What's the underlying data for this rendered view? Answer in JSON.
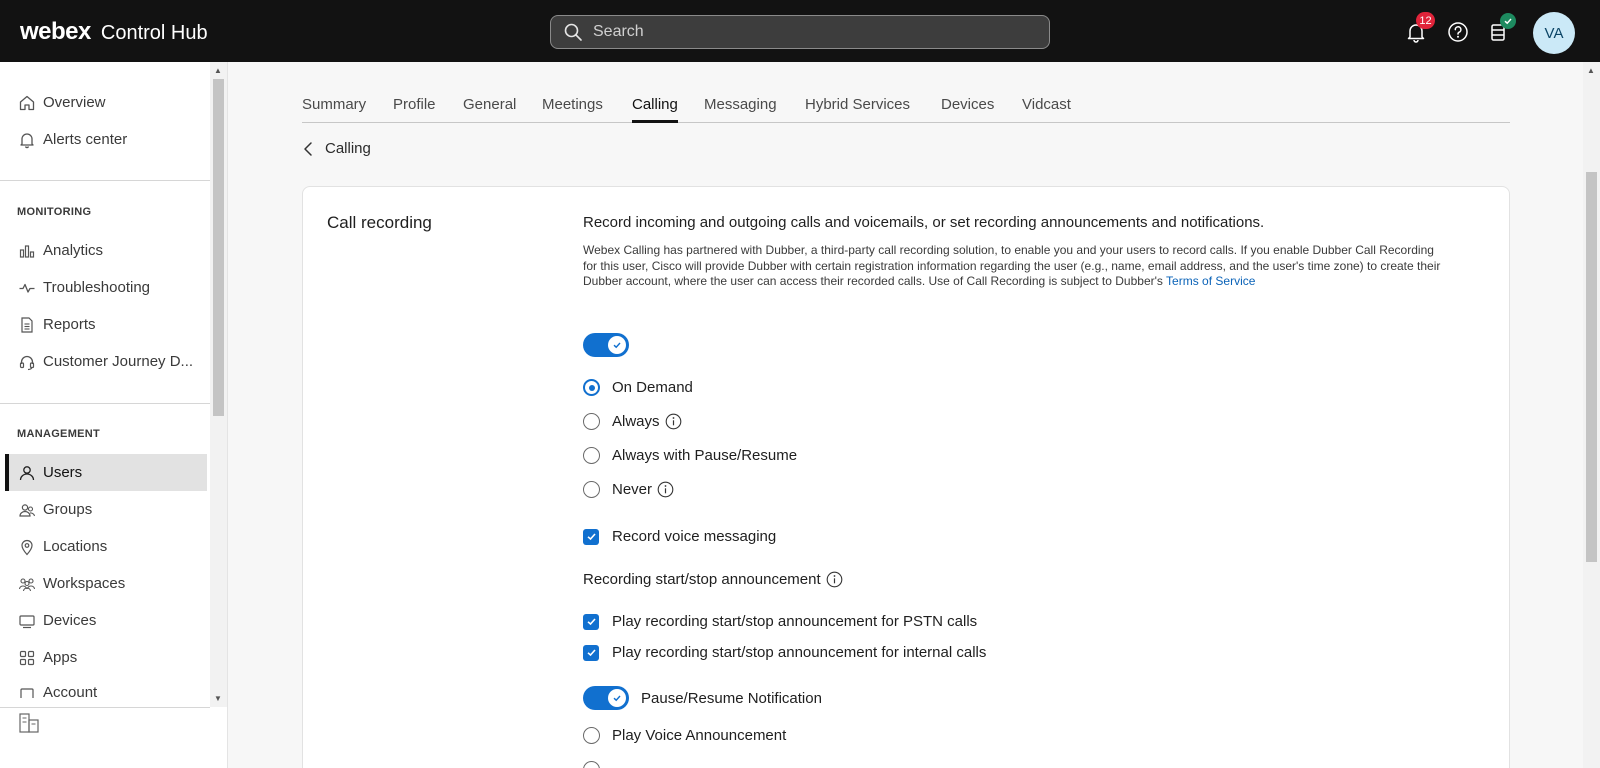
{
  "header": {
    "brand_webex": "webex",
    "brand_product": "Control Hub",
    "search_placeholder": "Search",
    "notification_count": "12",
    "avatar_initials": "VA"
  },
  "sidebar": {
    "top_items": [
      {
        "label": "Overview",
        "icon": "home-icon"
      },
      {
        "label": "Alerts center",
        "icon": "bell-icon"
      }
    ],
    "monitoring_label": "MONITORING",
    "monitoring_items": [
      {
        "label": "Analytics",
        "icon": "bar-chart-icon"
      },
      {
        "label": "Troubleshooting",
        "icon": "pulse-icon"
      },
      {
        "label": "Reports",
        "icon": "document-icon"
      },
      {
        "label": "Customer Journey D...",
        "icon": "headset-icon"
      }
    ],
    "management_label": "MANAGEMENT",
    "management_items": [
      {
        "label": "Users",
        "icon": "user-icon",
        "active": true
      },
      {
        "label": "Groups",
        "icon": "group-icon"
      },
      {
        "label": "Locations",
        "icon": "location-pin-icon"
      },
      {
        "label": "Workspaces",
        "icon": "workspaces-icon"
      },
      {
        "label": "Devices",
        "icon": "device-icon"
      },
      {
        "label": "Apps",
        "icon": "apps-grid-icon"
      },
      {
        "label": "Account",
        "icon": "account-icon"
      }
    ]
  },
  "tabs": [
    {
      "label": "Summary"
    },
    {
      "label": "Profile"
    },
    {
      "label": "General"
    },
    {
      "label": "Meetings"
    },
    {
      "label": "Calling",
      "active": true
    },
    {
      "label": "Messaging"
    },
    {
      "label": "Hybrid Services"
    },
    {
      "label": "Devices"
    },
    {
      "label": "Vidcast"
    }
  ],
  "breadcrumb": {
    "label": "Calling"
  },
  "call_recording": {
    "title": "Call recording",
    "heading": "Record incoming and outgoing calls and voicemails, or set recording announcements and notifications.",
    "description": "Webex Calling has partnered with Dubber, a third-party call recording solution, to enable you and your users to record calls. If you enable Dubber Call Recording for this user, Cisco will provide Dubber with certain registration information regarding the user (e.g., name, email address, and the user's time zone) to create their Dubber account, where the user can access their recorded calls. Use of Call Recording is subject to Dubber's",
    "terms_link": "Terms of Service",
    "enabled": true,
    "mode_options": [
      {
        "label": "On Demand",
        "selected": true,
        "info": false
      },
      {
        "label": "Always",
        "selected": false,
        "info": true
      },
      {
        "label": "Always with Pause/Resume",
        "selected": false,
        "info": false
      },
      {
        "label": "Never",
        "selected": false,
        "info": true
      }
    ],
    "record_voice_messaging": "Record voice messaging",
    "announcement_heading": "Recording start/stop announcement",
    "announcement_pstn": "Play recording start/stop announcement for PSTN calls",
    "announcement_internal": "Play recording start/stop announcement for internal calls",
    "pause_resume_notification": "Pause/Resume Notification",
    "play_voice_announcement": "Play Voice Announcement"
  },
  "colors": {
    "accent": "#1170cf",
    "topbar": "#121212",
    "badge": "#e0243a"
  }
}
